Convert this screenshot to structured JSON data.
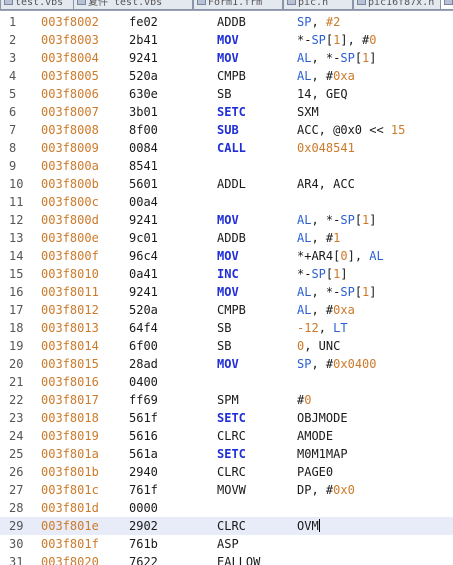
{
  "tabs": [
    {
      "label": "test.vbs",
      "active": false
    },
    {
      "label": "复件 test.vbs",
      "active": false
    },
    {
      "label": "Form1.frm",
      "active": false
    },
    {
      "label": "pic.h",
      "active": false
    },
    {
      "label": "pic16f87x.h",
      "active": false
    },
    {
      "label": "t",
      "active": true
    }
  ],
  "colors": {
    "address": "#cc7a2a",
    "keyword": "#1f2ed6",
    "register": "#2a5fd6",
    "number": "#cc7a2a",
    "current_line_bg": "#e8ecf8"
  },
  "lines": [
    {
      "num": "1",
      "addr": "003f8002",
      "hex": "fe02",
      "mn": "ADDB",
      "kw": false,
      "ops": [
        [
          "reg",
          "SP"
        ],
        [
          "plain",
          ", "
        ],
        [
          "num",
          "#2"
        ]
      ]
    },
    {
      "num": "2",
      "addr": "003f8003",
      "hex": "2b41",
      "mn": "MOV",
      "kw": true,
      "ops": [
        [
          "plain",
          "*-"
        ],
        [
          "reg",
          "SP"
        ],
        [
          "plain",
          "["
        ],
        [
          "num",
          "1"
        ],
        [
          "plain",
          "], #"
        ],
        [
          "num",
          "0"
        ]
      ]
    },
    {
      "num": "3",
      "addr": "003f8004",
      "hex": "9241",
      "mn": "MOV",
      "kw": true,
      "ops": [
        [
          "reg",
          "AL"
        ],
        [
          "plain",
          ", *-"
        ],
        [
          "reg",
          "SP"
        ],
        [
          "plain",
          "["
        ],
        [
          "num",
          "1"
        ],
        [
          "plain",
          "]"
        ]
      ]
    },
    {
      "num": "4",
      "addr": "003f8005",
      "hex": "520a",
      "mn": "CMPB",
      "kw": false,
      "ops": [
        [
          "reg",
          "AL"
        ],
        [
          "plain",
          ", #"
        ],
        [
          "num",
          "0xa"
        ]
      ]
    },
    {
      "num": "5",
      "addr": "003f8006",
      "hex": "630e",
      "mn": "SB",
      "kw": false,
      "ops": [
        [
          "plain",
          "14, GEQ"
        ]
      ]
    },
    {
      "num": "6",
      "addr": "003f8007",
      "hex": "3b01",
      "mn": "SETC",
      "kw": true,
      "ops": [
        [
          "plain",
          "SXM"
        ]
      ]
    },
    {
      "num": "7",
      "addr": "003f8008",
      "hex": "8f00",
      "mn": "SUB",
      "kw": true,
      "ops": [
        [
          "plain",
          "ACC, @0x0 << "
        ],
        [
          "num",
          "15"
        ]
      ]
    },
    {
      "num": "8",
      "addr": "003f8009",
      "hex": "0084",
      "mn": "CALL",
      "kw": true,
      "ops": [
        [
          "num",
          "0x048541"
        ]
      ]
    },
    {
      "num": "9",
      "addr": "003f800a",
      "hex": "8541",
      "mn": "",
      "kw": false,
      "ops": []
    },
    {
      "num": "10",
      "addr": "003f800b",
      "hex": "5601",
      "mn": "ADDL",
      "kw": false,
      "ops": [
        [
          "plain",
          "AR4, ACC"
        ]
      ]
    },
    {
      "num": "11",
      "addr": "003f800c",
      "hex": "00a4",
      "mn": "",
      "kw": false,
      "ops": []
    },
    {
      "num": "12",
      "addr": "003f800d",
      "hex": "9241",
      "mn": "MOV",
      "kw": true,
      "ops": [
        [
          "reg",
          "AL"
        ],
        [
          "plain",
          ", *-"
        ],
        [
          "reg",
          "SP"
        ],
        [
          "plain",
          "["
        ],
        [
          "num",
          "1"
        ],
        [
          "plain",
          "]"
        ]
      ]
    },
    {
      "num": "13",
      "addr": "003f800e",
      "hex": "9c01",
      "mn": "ADDB",
      "kw": false,
      "ops": [
        [
          "reg",
          "AL"
        ],
        [
          "plain",
          ", #"
        ],
        [
          "num",
          "1"
        ]
      ]
    },
    {
      "num": "14",
      "addr": "003f800f",
      "hex": "96c4",
      "mn": "MOV",
      "kw": true,
      "ops": [
        [
          "plain",
          "*+AR4["
        ],
        [
          "num",
          "0"
        ],
        [
          "plain",
          "], "
        ],
        [
          "reg",
          "AL"
        ]
      ]
    },
    {
      "num": "15",
      "addr": "003f8010",
      "hex": "0a41",
      "mn": "INC",
      "kw": true,
      "ops": [
        [
          "plain",
          "*-"
        ],
        [
          "reg",
          "SP"
        ],
        [
          "plain",
          "["
        ],
        [
          "num",
          "1"
        ],
        [
          "plain",
          "]"
        ]
      ]
    },
    {
      "num": "16",
      "addr": "003f8011",
      "hex": "9241",
      "mn": "MOV",
      "kw": true,
      "ops": [
        [
          "reg",
          "AL"
        ],
        [
          "plain",
          ", *-"
        ],
        [
          "reg",
          "SP"
        ],
        [
          "plain",
          "["
        ],
        [
          "num",
          "1"
        ],
        [
          "plain",
          "]"
        ]
      ]
    },
    {
      "num": "17",
      "addr": "003f8012",
      "hex": "520a",
      "mn": "CMPB",
      "kw": false,
      "ops": [
        [
          "reg",
          "AL"
        ],
        [
          "plain",
          ", #"
        ],
        [
          "num",
          "0xa"
        ]
      ]
    },
    {
      "num": "18",
      "addr": "003f8013",
      "hex": "64f4",
      "mn": "SB",
      "kw": false,
      "ops": [
        [
          "num",
          "-12"
        ],
        [
          "plain",
          ", "
        ],
        [
          "reg",
          "LT"
        ]
      ]
    },
    {
      "num": "19",
      "addr": "003f8014",
      "hex": "6f00",
      "mn": "SB",
      "kw": false,
      "ops": [
        [
          "num",
          "0"
        ],
        [
          "plain",
          ", UNC"
        ]
      ]
    },
    {
      "num": "20",
      "addr": "003f8015",
      "hex": "28ad",
      "mn": "MOV",
      "kw": true,
      "ops": [
        [
          "reg",
          "SP"
        ],
        [
          "plain",
          ", #"
        ],
        [
          "num",
          "0x0400"
        ]
      ]
    },
    {
      "num": "21",
      "addr": "003f8016",
      "hex": "0400",
      "mn": "",
      "kw": false,
      "ops": []
    },
    {
      "num": "22",
      "addr": "003f8017",
      "hex": "ff69",
      "mn": "SPM",
      "kw": false,
      "ops": [
        [
          "plain",
          "#"
        ],
        [
          "num",
          "0"
        ]
      ]
    },
    {
      "num": "23",
      "addr": "003f8018",
      "hex": "561f",
      "mn": "SETC",
      "kw": true,
      "ops": [
        [
          "plain",
          "OBJMODE"
        ]
      ]
    },
    {
      "num": "24",
      "addr": "003f8019",
      "hex": "5616",
      "mn": "CLRC",
      "kw": false,
      "ops": [
        [
          "plain",
          "AMODE"
        ]
      ]
    },
    {
      "num": "25",
      "addr": "003f801a",
      "hex": "561a",
      "mn": "SETC",
      "kw": true,
      "ops": [
        [
          "plain",
          "M0M1MAP"
        ]
      ]
    },
    {
      "num": "26",
      "addr": "003f801b",
      "hex": "2940",
      "mn": "CLRC",
      "kw": false,
      "ops": [
        [
          "plain",
          "PAGE0"
        ]
      ]
    },
    {
      "num": "27",
      "addr": "003f801c",
      "hex": "761f",
      "mn": "MOVW",
      "kw": false,
      "ops": [
        [
          "plain",
          "DP, #"
        ],
        [
          "num",
          "0x0"
        ]
      ]
    },
    {
      "num": "28",
      "addr": "003f801d",
      "hex": "0000",
      "mn": "",
      "kw": false,
      "ops": []
    },
    {
      "num": "29",
      "addr": "003f801e",
      "hex": "2902",
      "mn": "CLRC",
      "kw": false,
      "ops": [
        [
          "plain",
          "OVM"
        ]
      ],
      "current": true
    },
    {
      "num": "30",
      "addr": "003f801f",
      "hex": "761b",
      "mn": "ASP",
      "kw": false,
      "ops": []
    },
    {
      "num": "31",
      "addr": "003f8020",
      "hex": "7622",
      "mn": "EALLOW",
      "kw": false,
      "ops": []
    }
  ]
}
